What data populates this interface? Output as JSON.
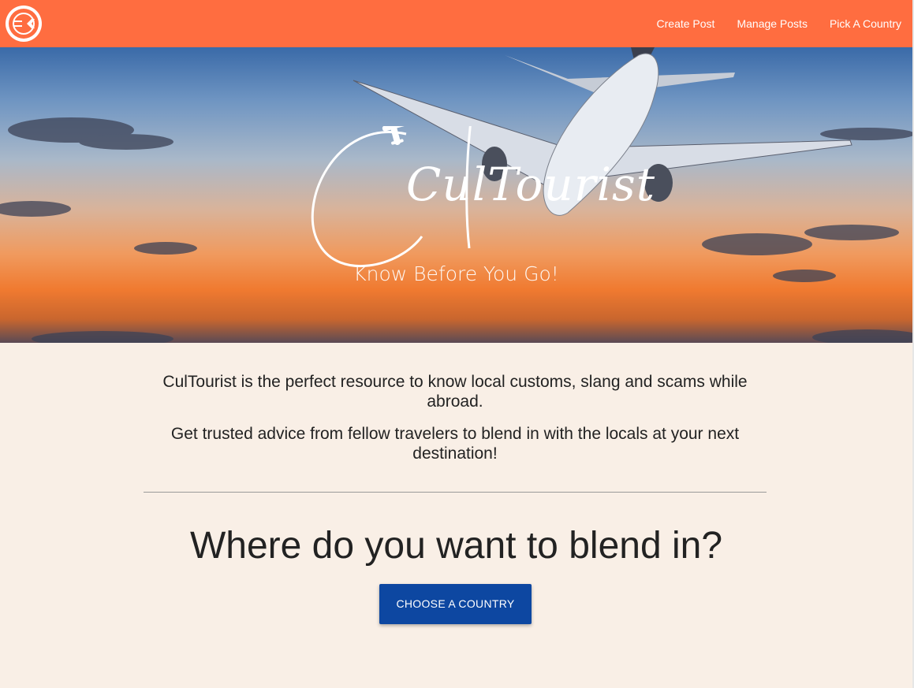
{
  "nav": {
    "logo_icon": "airplane-logo-icon",
    "links": [
      {
        "label": "Create Post"
      },
      {
        "label": "Manage Posts"
      },
      {
        "label": "Pick A Country"
      }
    ]
  },
  "hero": {
    "brand": "CulTourist",
    "tagline": "Know Before You Go!"
  },
  "intro": {
    "p1": "CulTourist is the perfect resource to know local customs, slang and scams while abroad.",
    "p2": "Get trusted advice from fellow travelers to blend in with the locals at your next destination!"
  },
  "main": {
    "question": "Where do you want to blend in?",
    "cta_label": "CHOOSE A COUNTRY"
  },
  "colors": {
    "navbar": "#ff6d40",
    "page_bg": "#f9efe6",
    "button": "#0d47a1"
  }
}
